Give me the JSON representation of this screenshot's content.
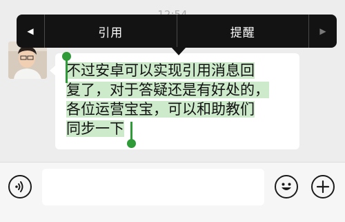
{
  "status": {
    "time": "12:54"
  },
  "context_menu": {
    "items": [
      "引用",
      "提醒"
    ],
    "prev_icon": "triangle-left-icon",
    "next_icon": "triangle-right-icon"
  },
  "message": {
    "sender_avatar": "avatar-photo",
    "lines": [
      "不过安卓可以实现引用消息回",
      "复了，对于答疑还是有好处的，",
      "各位运营宝宝，可以和助教们",
      "同步一下"
    ]
  },
  "input_bar": {
    "voice_icon": "voice-icon",
    "emoji_icon": "emoji-icon",
    "add_icon": "plus-icon"
  },
  "colors": {
    "selection_highlight": "#cdeacb",
    "selection_handle": "#2f9a38",
    "menu_background": "#131313"
  }
}
